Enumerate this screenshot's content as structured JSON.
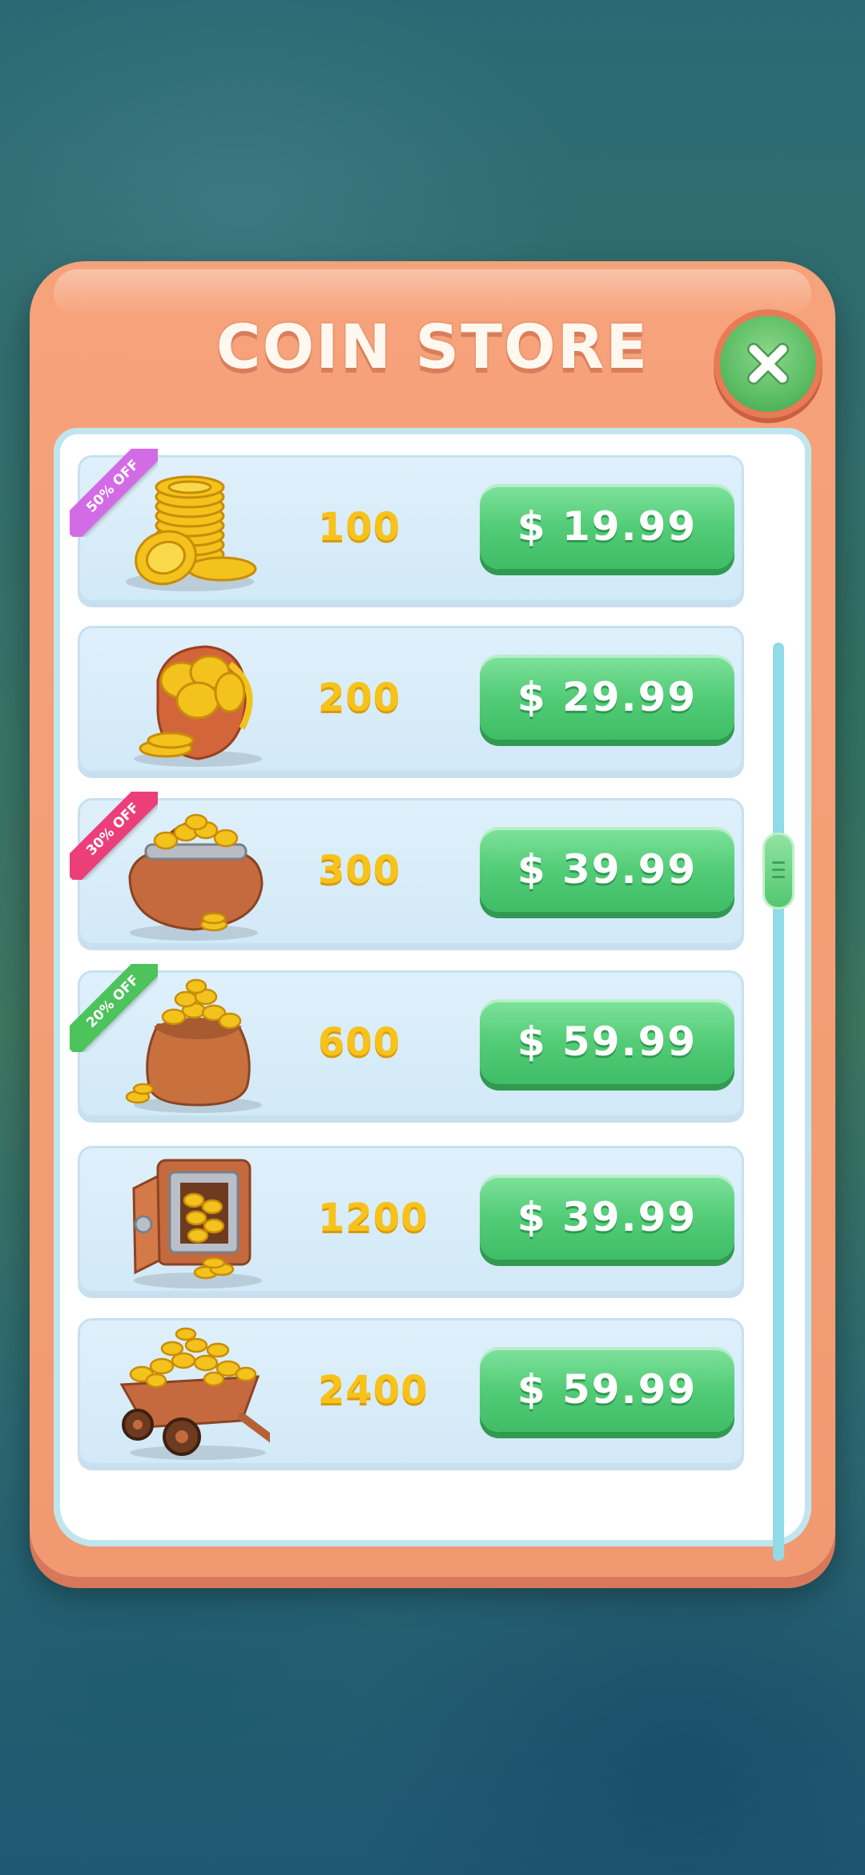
{
  "store": {
    "title": "COIN STORE",
    "close_icon": "close-x-icon",
    "colors": {
      "panel": "#f19a72",
      "button": "#53cc77",
      "amount": "#f7c21a"
    },
    "items": [
      {
        "amount": "100",
        "price": "$ 19.99",
        "icon": "coin-stack-icon",
        "badge": "50% OFF",
        "badge_color": "#d36be6"
      },
      {
        "amount": "200",
        "price": "$ 29.99",
        "icon": "coin-pot-icon",
        "badge": "",
        "badge_color": ""
      },
      {
        "amount": "300",
        "price": "$ 39.99",
        "icon": "coin-purse-icon",
        "badge": "30% OFF",
        "badge_color": "#ec3f7a"
      },
      {
        "amount": "600",
        "price": "$ 59.99",
        "icon": "coin-sack-icon",
        "badge": "20% OFF",
        "badge_color": "#4cc35b"
      },
      {
        "amount": "1200",
        "price": "$ 39.99",
        "icon": "coin-safe-icon",
        "badge": "",
        "badge_color": ""
      },
      {
        "amount": "2400",
        "price": "$ 59.99",
        "icon": "coin-wheelbarrow-icon",
        "badge": "",
        "badge_color": ""
      }
    ]
  }
}
